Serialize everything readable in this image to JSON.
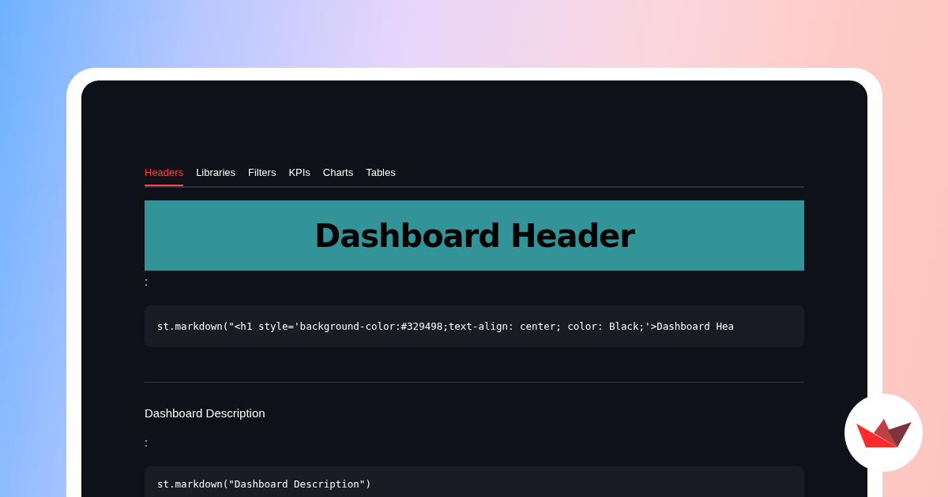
{
  "tabs": [
    {
      "label": "Headers",
      "selected": true
    },
    {
      "label": "Libraries",
      "selected": false
    },
    {
      "label": "Filters",
      "selected": false
    },
    {
      "label": "KPIs",
      "selected": false
    },
    {
      "label": "Charts",
      "selected": false
    },
    {
      "label": "Tables",
      "selected": false
    }
  ],
  "banner": {
    "title": "Dashboard Header",
    "color": "#329498"
  },
  "sections": [
    {
      "label": ":",
      "code": "st.markdown(\"<h1 style='background-color:#329498;text-align: center; color: Black;'>Dashboard Hea"
    },
    {
      "heading": "Dashboard Description",
      "label": ":",
      "code": "st.markdown(\"Dashboard Description\")"
    }
  ]
}
